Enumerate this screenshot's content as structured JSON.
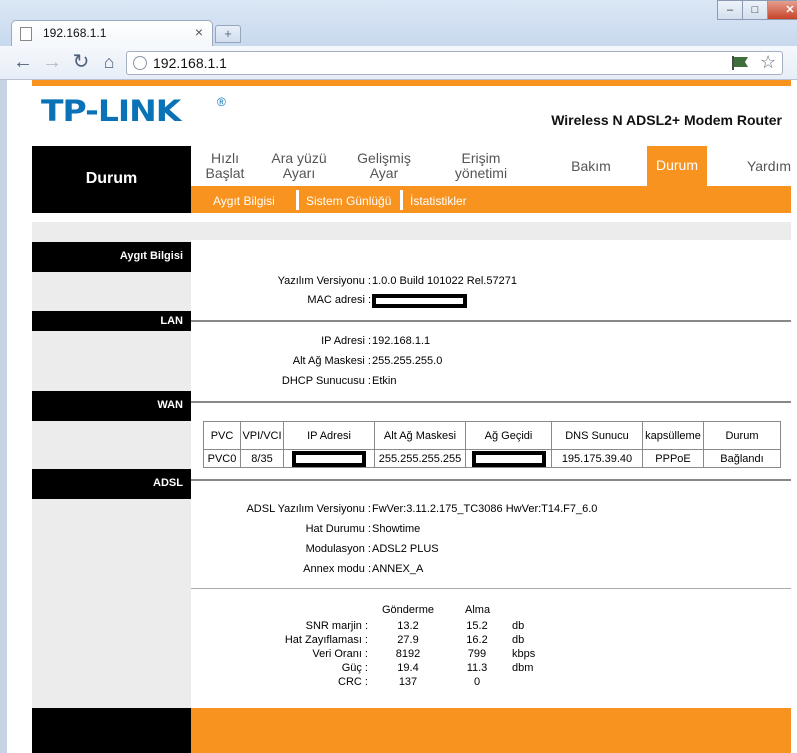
{
  "browser": {
    "tab_title": "192.168.1.1",
    "tab_close": "×",
    "new_tab": "+",
    "url": "192.168.1.1",
    "window_controls": [
      "–",
      "□",
      "✕"
    ]
  },
  "brand": {
    "logo": "TP-LINK",
    "logo_mark": "®",
    "product": "Wireless N ADSL2+ Modem Router",
    "accent": "#f7931e",
    "logo_color": "#0a72b7"
  },
  "section_title": "Durum",
  "main_nav": [
    {
      "label": "Hızlı\nBaşlat"
    },
    {
      "label": "Ara yüzü\nAyarı"
    },
    {
      "label": "Gelişmiş\nAyar"
    },
    {
      "label": "Erişim\nyönetimi"
    },
    {
      "label": "Bakım"
    },
    {
      "label": "Durum",
      "active": true
    },
    {
      "label": "Yardım"
    }
  ],
  "sub_nav": [
    "Aygıt Bilgisi",
    "Sistem Günlüğü",
    "İstatistikler"
  ],
  "device_info": {
    "heading": "Aygıt Bilgisi",
    "firmware_label": "Yazılım Versiyonu :",
    "firmware_value": "1.0.0 Build 101022 Rel.57271",
    "mac_label": "MAC adresi :"
  },
  "lan": {
    "heading": "LAN",
    "ip_label": "IP Adresi :",
    "ip_value": "192.168.1.1",
    "mask_label": "Alt Ağ Maskesi :",
    "mask_value": "255.255.255.0",
    "dhcp_label": "DHCP Sunucusu :",
    "dhcp_value": "Etkin"
  },
  "wan": {
    "heading": "WAN",
    "columns": [
      "PVC",
      "VPI/VCI",
      "IP Adresi",
      "Alt Ağ Maskesi",
      "Ağ Geçidi",
      "DNS Sunucu",
      "kapsülleme",
      "Durum"
    ],
    "row": {
      "pvc": "PVC0",
      "vpi_vci": "8/35",
      "mask": "255.255.255.255",
      "dns": "195.175.39.40",
      "encap": "PPPoE",
      "status": "Bağlandı"
    }
  },
  "adsl": {
    "heading": "ADSL",
    "fw_label": "ADSL Yazılım Versiyonu :",
    "fw_value": "FwVer:3.11.2.175_TC3086 HwVer:T14.F7_6.0",
    "line_label": "Hat Durumu :",
    "line_value": "Showtime",
    "mod_label": "Modulasyon :",
    "mod_value": "ADSL2 PLUS",
    "annex_label": "Annex modu :",
    "annex_value": "ANNEX_A"
  },
  "stats": {
    "col_send": "Gönderme",
    "col_recv": "Alma",
    "rows": [
      {
        "label": "SNR marjin :",
        "send": "13.2",
        "recv": "15.2",
        "unit": "db"
      },
      {
        "label": "Hat Zayıflaması :",
        "send": "27.9",
        "recv": "16.2",
        "unit": "db"
      },
      {
        "label": "Veri Oranı :",
        "send": "8192",
        "recv": "799",
        "unit": "kbps"
      },
      {
        "label": "Güç :",
        "send": "19.4",
        "recv": "11.3",
        "unit": "dbm"
      },
      {
        "label": "CRC :",
        "send": "137",
        "recv": "0",
        "unit": ""
      }
    ]
  }
}
